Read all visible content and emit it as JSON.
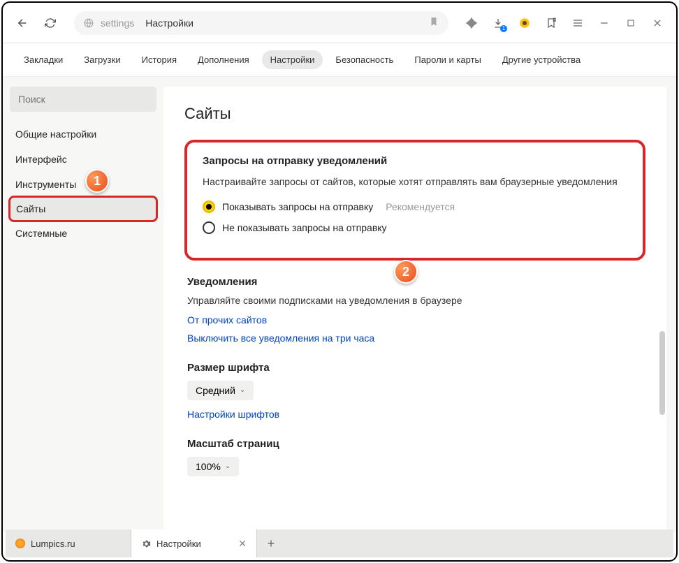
{
  "address": {
    "prefix": "settings",
    "title": "Настройки"
  },
  "topnav": {
    "items": [
      "Закладки",
      "Загрузки",
      "История",
      "Дополнения",
      "Настройки",
      "Безопасность",
      "Пароли и карты",
      "Другие устройства"
    ],
    "activeIndex": 4
  },
  "sidebar": {
    "search_placeholder": "Поиск",
    "items": [
      "Общие настройки",
      "Интерфейс",
      "Инструменты",
      "Сайты",
      "Системные"
    ],
    "activeIndex": 3
  },
  "page": {
    "title": "Сайты",
    "notifications_request": {
      "title": "Запросы на отправку уведомлений",
      "desc": "Настраивайте запросы от сайтов, которые хотят отправлять вам браузерные уведомления",
      "opt_show": "Показывать запросы на отправку",
      "opt_show_hint": "Рекомендуется",
      "opt_hide": "Не показывать запросы на отправку"
    },
    "notifications": {
      "title": "Уведомления",
      "desc": "Управляйте своими подписками на уведомления в браузере",
      "link1": "От прочих сайтов",
      "link2": "Выключить все уведомления на три часа"
    },
    "font_size": {
      "title": "Размер шрифта",
      "value": "Средний",
      "link": "Настройки шрифтов"
    },
    "page_zoom": {
      "title": "Масштаб страниц",
      "value": "100%"
    }
  },
  "tabs": {
    "t1": "Lumpics.ru",
    "t2": "Настройки"
  },
  "badges": {
    "b1": "1",
    "b2": "2"
  },
  "dl_count": "1"
}
